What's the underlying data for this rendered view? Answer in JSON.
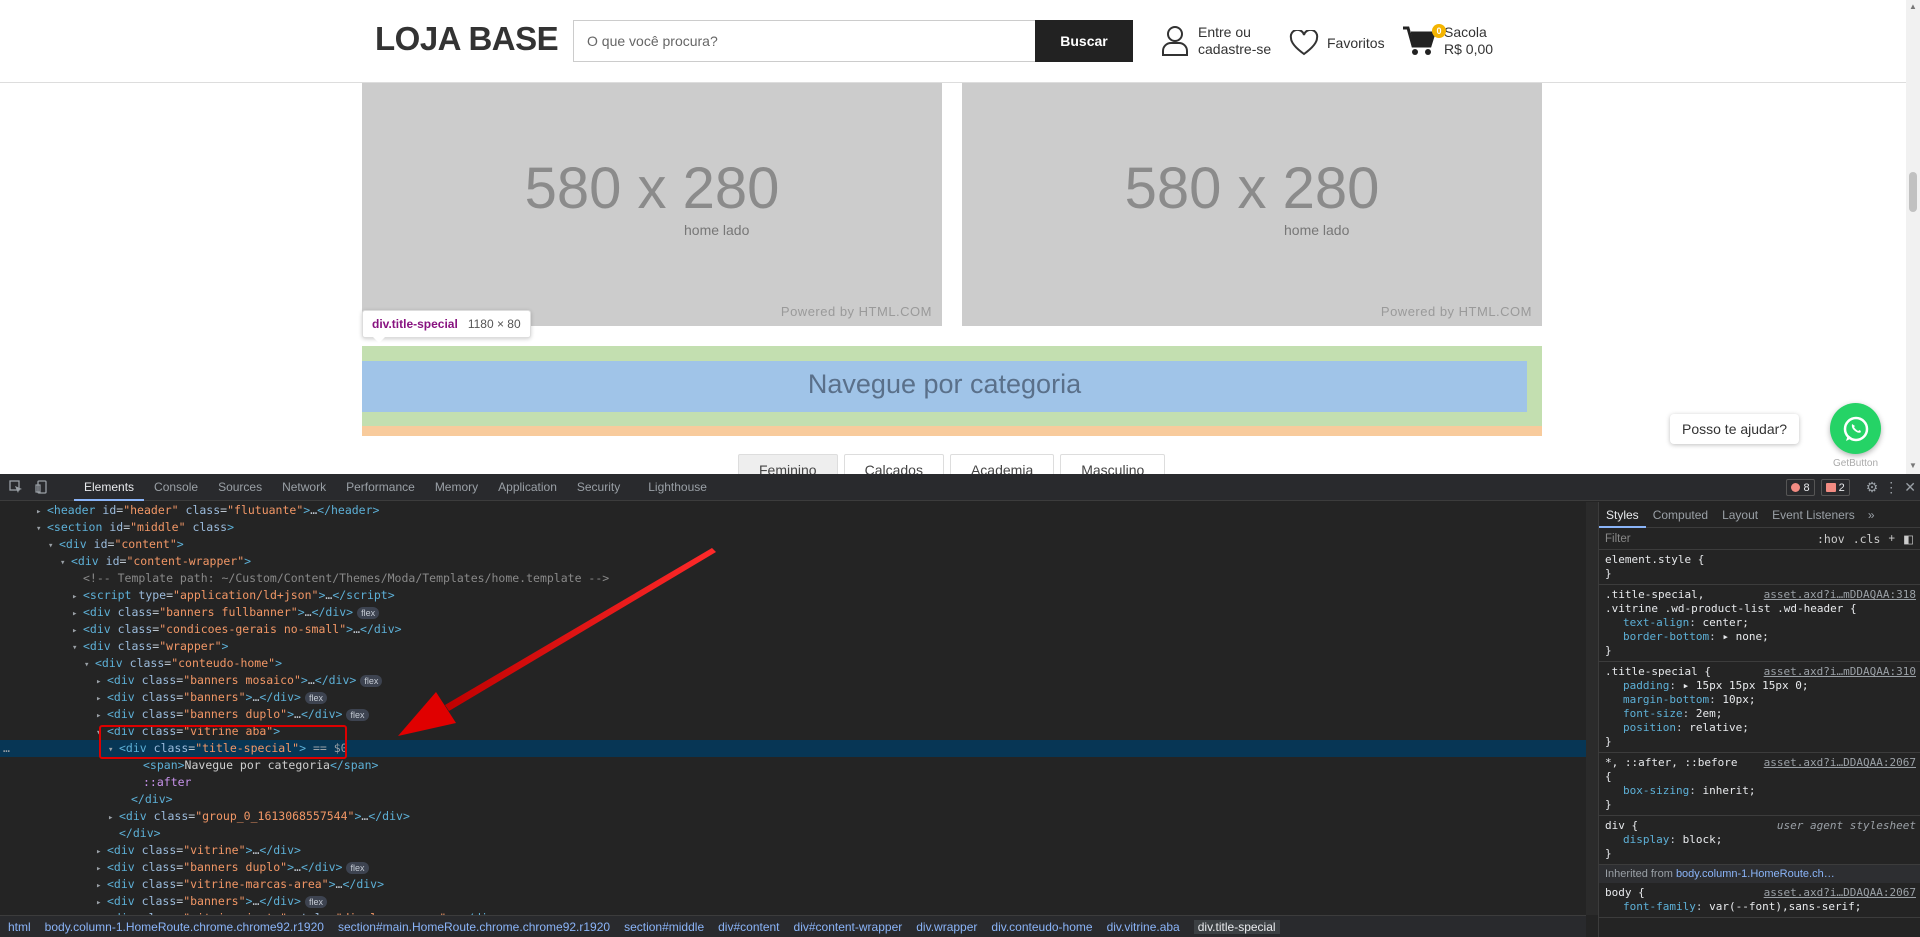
{
  "site": {
    "logo": "LOJA BASE",
    "search_placeholder": "O que você procura?",
    "search_button": "Buscar",
    "account_line1": "Entre ou",
    "account_line2": "cadastre-se",
    "favorites": "Favoritos",
    "cart_count": "0",
    "cart_label": "Sacola",
    "cart_total": "R$ 0,00",
    "banners": [
      {
        "size": "580 x 280",
        "sub": "home lado",
        "powered": "Powered by HTML.COM"
      },
      {
        "size": "580 x 280",
        "sub": "home lado",
        "powered": "Powered by HTML.COM"
      }
    ],
    "section_title": "Navegue por categoria",
    "tabs": [
      "Feminino",
      "Calçados",
      "Academia",
      "Masculino"
    ],
    "whatsapp_bubble": "Posso te ajudar?",
    "whatsapp_caption": "GetButton"
  },
  "inspector_tooltip": {
    "selector": "div.title-special",
    "size": "1180 × 80"
  },
  "devtools": {
    "tabs": [
      "Elements",
      "Console",
      "Sources",
      "Network",
      "Performance",
      "Memory",
      "Application",
      "Security",
      "Lighthouse"
    ],
    "active_tab": "Elements",
    "error_count": "8",
    "issue_count": "2",
    "dom_lines": [
      {
        "indent": 3,
        "tri": "▸",
        "html": "<span class='tg'>&lt;header</span> <span class='at'>id</span>=<span class='av'>\"header\"</span> <span class='at'>class</span>=<span class='av'>\"flutuante\"</span><span class='tg'>&gt;</span>…<span class='tg'>&lt;/header&gt;</span>"
      },
      {
        "indent": 3,
        "tri": "▾",
        "html": "<span class='tg'>&lt;section</span> <span class='at'>id</span>=<span class='av'>\"middle\"</span> <span class='at'>class</span><span class='tg'>&gt;</span>"
      },
      {
        "indent": 4,
        "tri": "▾",
        "html": "<span class='tg'>&lt;div</span> <span class='at'>id</span>=<span class='av'>\"content\"</span><span class='tg'>&gt;</span>"
      },
      {
        "indent": 5,
        "tri": "▾",
        "html": "<span class='tg'>&lt;div</span> <span class='at'>id</span>=<span class='av'>\"content-wrapper\"</span><span class='tg'>&gt;</span>"
      },
      {
        "indent": 6,
        "tri": " ",
        "html": "<span class='cm'>&lt;!-- Template path: ~/Custom/Content/Themes/Moda/Templates/home.template --&gt;</span>"
      },
      {
        "indent": 6,
        "tri": "▸",
        "html": "<span class='tg'>&lt;script</span> <span class='at'>type</span>=<span class='av'>\"application/ld+json\"</span><span class='tg'>&gt;</span>…<span class='tg'>&lt;/script&gt;</span>"
      },
      {
        "indent": 6,
        "tri": "▸",
        "html": "<span class='tg'>&lt;div</span> <span class='at'>class</span>=<span class='av'>\"banners fullbanner\"</span><span class='tg'>&gt;</span>…<span class='tg'>&lt;/div&gt;</span><span class='flex'>flex</span>"
      },
      {
        "indent": 6,
        "tri": "▸",
        "html": "<span class='tg'>&lt;div</span> <span class='at'>class</span>=<span class='av'>\"condicoes-gerais no-small\"</span><span class='tg'>&gt;</span>…<span class='tg'>&lt;/div&gt;</span>"
      },
      {
        "indent": 6,
        "tri": "▾",
        "html": "<span class='tg'>&lt;div</span> <span class='at'>class</span>=<span class='av'>\"wrapper\"</span><span class='tg'>&gt;</span>"
      },
      {
        "indent": 7,
        "tri": "▾",
        "html": "<span class='tg'>&lt;div</span> <span class='at'>class</span>=<span class='av'>\"conteudo-home\"</span><span class='tg'>&gt;</span>"
      },
      {
        "indent": 8,
        "tri": "▸",
        "html": "<span class='tg'>&lt;div</span> <span class='at'>class</span>=<span class='av'>\"banners mosaico\"</span><span class='tg'>&gt;</span>…<span class='tg'>&lt;/div&gt;</span><span class='flex'>flex</span>"
      },
      {
        "indent": 8,
        "tri": "▸",
        "html": "<span class='tg'>&lt;div</span> <span class='at'>class</span>=<span class='av'>\"banners\"</span><span class='tg'>&gt;</span>…<span class='tg'>&lt;/div&gt;</span><span class='flex'>flex</span>"
      },
      {
        "indent": 8,
        "tri": "▸",
        "html": "<span class='tg'>&lt;div</span> <span class='at'>class</span>=<span class='av'>\"banners duplo\"</span><span class='tg'>&gt;</span>…<span class='tg'>&lt;/div&gt;</span><span class='flex'>flex</span>"
      },
      {
        "indent": 8,
        "tri": "▾",
        "html": "<span class='tg'>&lt;div</span> <span class='at'>class</span>=<span class='av'>\"vitrine aba\"</span><span class='tg'>&gt;</span>"
      },
      {
        "indent": 9,
        "tri": "▾",
        "html": "<span class='tg'>&lt;div</span> <span class='at'>class</span>=<span class='av'>\"title-special\"</span><span class='tg'>&gt;</span> <span class='eq'>== $0</span>",
        "selected": true
      },
      {
        "indent": 11,
        "tri": " ",
        "html": "<span class='tg'>&lt;span&gt;</span><span class='tx'>Navegue por categoria</span><span class='tg'>&lt;/span&gt;</span>"
      },
      {
        "indent": 11,
        "tri": " ",
        "html": "<span class='ps'>::after</span>"
      },
      {
        "indent": 10,
        "tri": " ",
        "html": "<span class='tg'>&lt;/div&gt;</span>"
      },
      {
        "indent": 9,
        "tri": "▸",
        "html": "<span class='tg'>&lt;div</span> <span class='at'>class</span>=<span class='av'>\"group_0_1613068557544\"</span><span class='tg'>&gt;</span>…<span class='tg'>&lt;/div&gt;</span>"
      },
      {
        "indent": 9,
        "tri": " ",
        "html": "<span class='tg'>&lt;/div&gt;</span>"
      },
      {
        "indent": 8,
        "tri": "▸",
        "html": "<span class='tg'>&lt;div</span> <span class='at'>class</span>=<span class='av'>\"vitrine\"</span><span class='tg'>&gt;</span>…<span class='tg'>&lt;/div&gt;</span>"
      },
      {
        "indent": 8,
        "tri": "▸",
        "html": "<span class='tg'>&lt;div</span> <span class='at'>class</span>=<span class='av'>\"banners duplo\"</span><span class='tg'>&gt;</span>…<span class='tg'>&lt;/div&gt;</span><span class='flex'>flex</span>"
      },
      {
        "indent": 8,
        "tri": "▸",
        "html": "<span class='tg'>&lt;div</span> <span class='at'>class</span>=<span class='av'>\"vitrine-marcas-area\"</span><span class='tg'>&gt;</span>…<span class='tg'>&lt;/div&gt;</span>"
      },
      {
        "indent": 8,
        "tri": "▸",
        "html": "<span class='tg'>&lt;div</span> <span class='at'>class</span>=<span class='av'>\"banners\"</span><span class='tg'>&gt;</span>…<span class='tg'>&lt;/div&gt;</span><span class='flex'>flex</span>"
      },
      {
        "indent": 8,
        "tri": "▸",
        "html": "<span class='tg'>&lt;div</span> <span class='at'>class</span>=<span class='av'>\"vitrine-jeste\"</span> <span class='at'>style</span>=<span class='av'>\"display: none;\"</span><span class='tg'>&gt;</span>…<span class='tg'>&lt;/div&gt;</span>"
      }
    ],
    "breadcrumbs": [
      "html",
      "body.column-1.HomeRoute.chrome.chrome92.r1920",
      "section#main.HomeRoute.chrome.chrome92.r1920",
      "section#middle",
      "div#content",
      "div#content-wrapper",
      "div.wrapper",
      "div.conteudo-home",
      "div.vitrine.aba",
      "div.title-special"
    ],
    "styles_tabs": [
      "Styles",
      "Computed",
      "Layout",
      "Event Listeners"
    ],
    "filter_placeholder": "Filter",
    "filter_hov": ":hov",
    "filter_cls": ".cls",
    "rules": [
      {
        "selector": "element.style {",
        "source": "",
        "props": [],
        "close": "}"
      },
      {
        "selector": ".title-special,",
        "selector2": ".vitrine .wd-product-list .wd-header {",
        "source": "asset.axd?i…mDDAQAA:318",
        "props": [
          [
            "text-align",
            "center;"
          ],
          [
            "border-bottom",
            "▸ none;"
          ]
        ],
        "close": "}"
      },
      {
        "selector": ".title-special {",
        "source": "asset.axd?i…mDDAQAA:310",
        "props": [
          [
            "padding",
            "▸ 15px 15px 15px 0;"
          ],
          [
            "margin-bottom",
            "10px;"
          ],
          [
            "font-size",
            "2em;"
          ],
          [
            "position",
            "relative;"
          ]
        ],
        "close": "}"
      },
      {
        "selector": "*, ::after, ::before",
        "selector2": "{",
        "source": "asset.axd?i…DDAQAA:2067",
        "props": [
          [
            "box-sizing",
            "inherit;"
          ]
        ],
        "close": "}"
      },
      {
        "selector": "div {",
        "source": "user agent stylesheet",
        "ua": true,
        "props": [
          [
            "display",
            "block;"
          ]
        ],
        "close": "}"
      }
    ],
    "inherited_label": "Inherited from",
    "inherited_from": "body.column-1.HomeRoute.ch…",
    "body_rule": {
      "selector": "body {",
      "source": "asset.axd?i…DDAQAA:2067",
      "prop": "font-family",
      "value": "var(--font),sans-serif;"
    }
  }
}
